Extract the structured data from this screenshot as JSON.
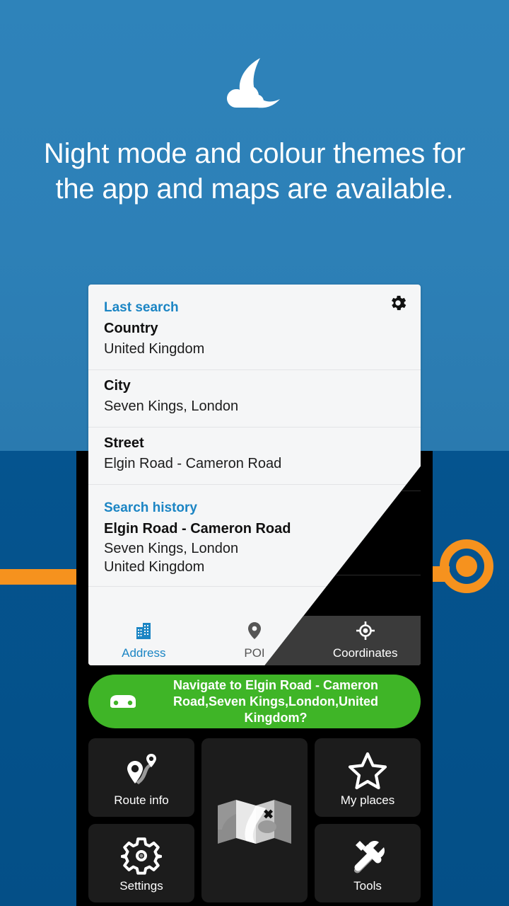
{
  "hero": {
    "icon": "moon-cloud-icon",
    "headline": "Night mode and colour themes for the app and maps are available."
  },
  "colors": {
    "bg_top": "#2E83BA",
    "bg_bottom": "#05548F",
    "accent_orange": "#F6921E",
    "link_blue": "#1B85C4",
    "navigate_green": "#3FB527",
    "night_tab_accent": "#F2A33C",
    "card_light": "#F5F6F7",
    "card_dark": "#000000"
  },
  "card": {
    "gear_icon": "gear-icon",
    "last_search_label": "Last search",
    "rows": [
      {
        "key": "Country",
        "value": "United Kingdom"
      },
      {
        "key": "City",
        "value": "Seven Kings, London"
      },
      {
        "key": "Street",
        "value": "Elgin Road - Cameron Road"
      }
    ],
    "search_history_label": "Search history",
    "history": {
      "title": "Elgin Road - Cameron Road",
      "line2": "Seven Kings, London",
      "line3": "United Kingdom"
    },
    "tabs": [
      {
        "label": "Address",
        "icon": "building-icon",
        "active": true
      },
      {
        "label": "POI",
        "icon": "map-pin-icon",
        "active": false
      },
      {
        "label": "Coordinates",
        "icon": "crosshair-icon",
        "active": false
      }
    ]
  },
  "phone": {
    "navigate_banner": {
      "icon": "car-icon",
      "text": "Navigate to Elgin Road - Cameron Road,Seven Kings,London,United Kingdom?"
    },
    "tiles": [
      {
        "label": "Route info",
        "icon": "route-pins-icon"
      },
      {
        "label": "My places",
        "icon": "star-outline-icon"
      },
      {
        "label": "Settings",
        "icon": "gear-outline-icon"
      },
      {
        "label": "Tools",
        "icon": "wrench-screwdriver-icon"
      },
      {
        "label": "",
        "icon": "folded-map-icon"
      }
    ]
  }
}
